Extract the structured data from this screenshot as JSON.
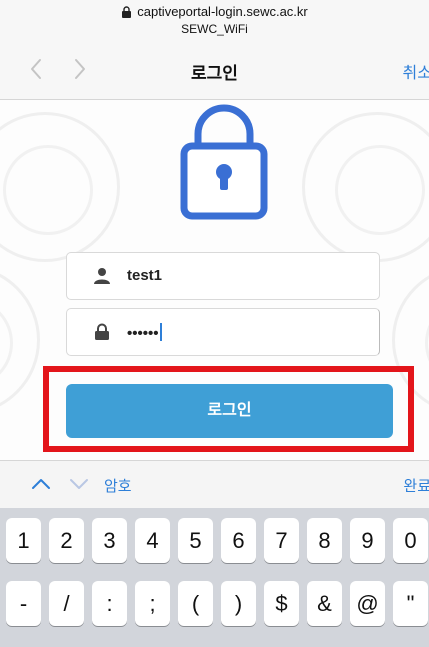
{
  "browser": {
    "url": "captiveportal-login.sewc.ac.kr",
    "network_name": "SEWC_WiFi",
    "title": "로그인",
    "cancel_label": "취소"
  },
  "form": {
    "username_value": "test1",
    "password_value": "••••••",
    "login_button_label": "로그인"
  },
  "accessory_bar": {
    "field_label": "암호",
    "done_label": "완료"
  },
  "keyboard": {
    "row1": [
      "1",
      "2",
      "3",
      "4",
      "5",
      "6",
      "7",
      "8",
      "9",
      "0"
    ],
    "row2": [
      "-",
      "/",
      ":",
      ";",
      "(",
      ")",
      "$",
      "&",
      "@",
      "\""
    ]
  },
  "colors": {
    "accent_blue": "#2e7fd8",
    "lock_blue": "#3a6fd4",
    "button_blue": "#3f9fd6",
    "highlight_red": "#e3151b"
  }
}
